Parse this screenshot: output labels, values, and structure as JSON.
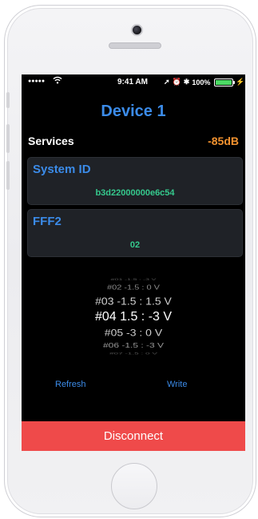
{
  "status_bar": {
    "signal": "●●●●●",
    "wifi_icon": "wifi-icon",
    "time": "9:41 AM",
    "location_icon": "➚",
    "alarm_icon": "⏰",
    "bluetooth_icon": "✱",
    "battery_percent": "100%",
    "battery_level": 1.0,
    "charging_icon": "⚡"
  },
  "header": {
    "title": "Device 1"
  },
  "services": {
    "label": "Services",
    "rssi": "-85dB"
  },
  "cards": [
    {
      "title": "System ID",
      "value": "b3d22000000e6c54"
    },
    {
      "title": "FFF2",
      "value": "02"
    }
  ],
  "picker": {
    "rows": [
      "#01 -1.5 : -3  V",
      "#02 -1.5 : 0  V",
      "#03 -1.5 : 1.5  V",
      "#04 1.5 : -3  V",
      "#05 -3 : 0  V",
      "#06 -1.5 : -3  V",
      "#07 -1.5 : 0  V"
    ],
    "selected_index": 3
  },
  "actions": {
    "refresh_label": "Refresh",
    "write_label": "Write"
  },
  "footer": {
    "disconnect_label": "Disconnect"
  },
  "colors": {
    "accent_blue": "#3b8be8",
    "value_green": "#35c98d",
    "rssi_orange": "#f2922f",
    "disconnect_red": "#ef4a4a"
  }
}
